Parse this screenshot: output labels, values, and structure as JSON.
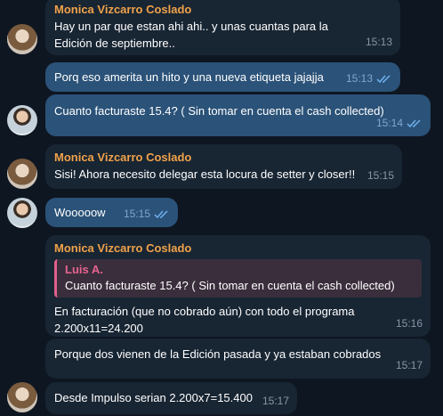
{
  "messages": [
    {
      "sender": "Monica Vizcarro Coslado",
      "text": "Hay un par que estan ahi ahi.. y unas cuantas para la Edición de septiembre..",
      "time": "15:13"
    },
    {
      "text": "Porq eso amerita un hito y una nueva etiqueta jajajja",
      "time": "15:13",
      "read": "double-check-icon"
    },
    {
      "text": "Cuanto facturaste 15.4? ( Sin tomar en cuenta el cash collected)",
      "time": "15:14",
      "read": "double-check-icon"
    },
    {
      "sender": "Monica Vizcarro Coslado",
      "text": "Sisi! Ahora necesito delegar esta locura de setter y closer!!",
      "time": "15:15"
    },
    {
      "text": "Wooooow",
      "time": "15:15",
      "read": "double-check-icon"
    },
    {
      "sender": "Monica Vizcarro Coslado",
      "reply": {
        "name": "Luis A.",
        "text": "Cuanto facturaste 15.4? ( Sin tomar en cuenta el cash collected)"
      },
      "text_line1": "En facturación (que no cobrado aún) con todo el programa",
      "text_line2": "2.200x11=24.200",
      "time": "15:16"
    },
    {
      "text": "Porque dos vienen de la Edición pasada y ya estaban cobrados",
      "time": "15:17"
    },
    {
      "text": "Desde Impulso serian 2.200x7=15.400",
      "time": "15:17"
    }
  ],
  "colors": {
    "background": "#0e1621",
    "incoming_bubble": "#182533",
    "outgoing_bubble": "#2b5278",
    "sender_name": "#f0a24a",
    "reply_name": "#e8638f"
  }
}
